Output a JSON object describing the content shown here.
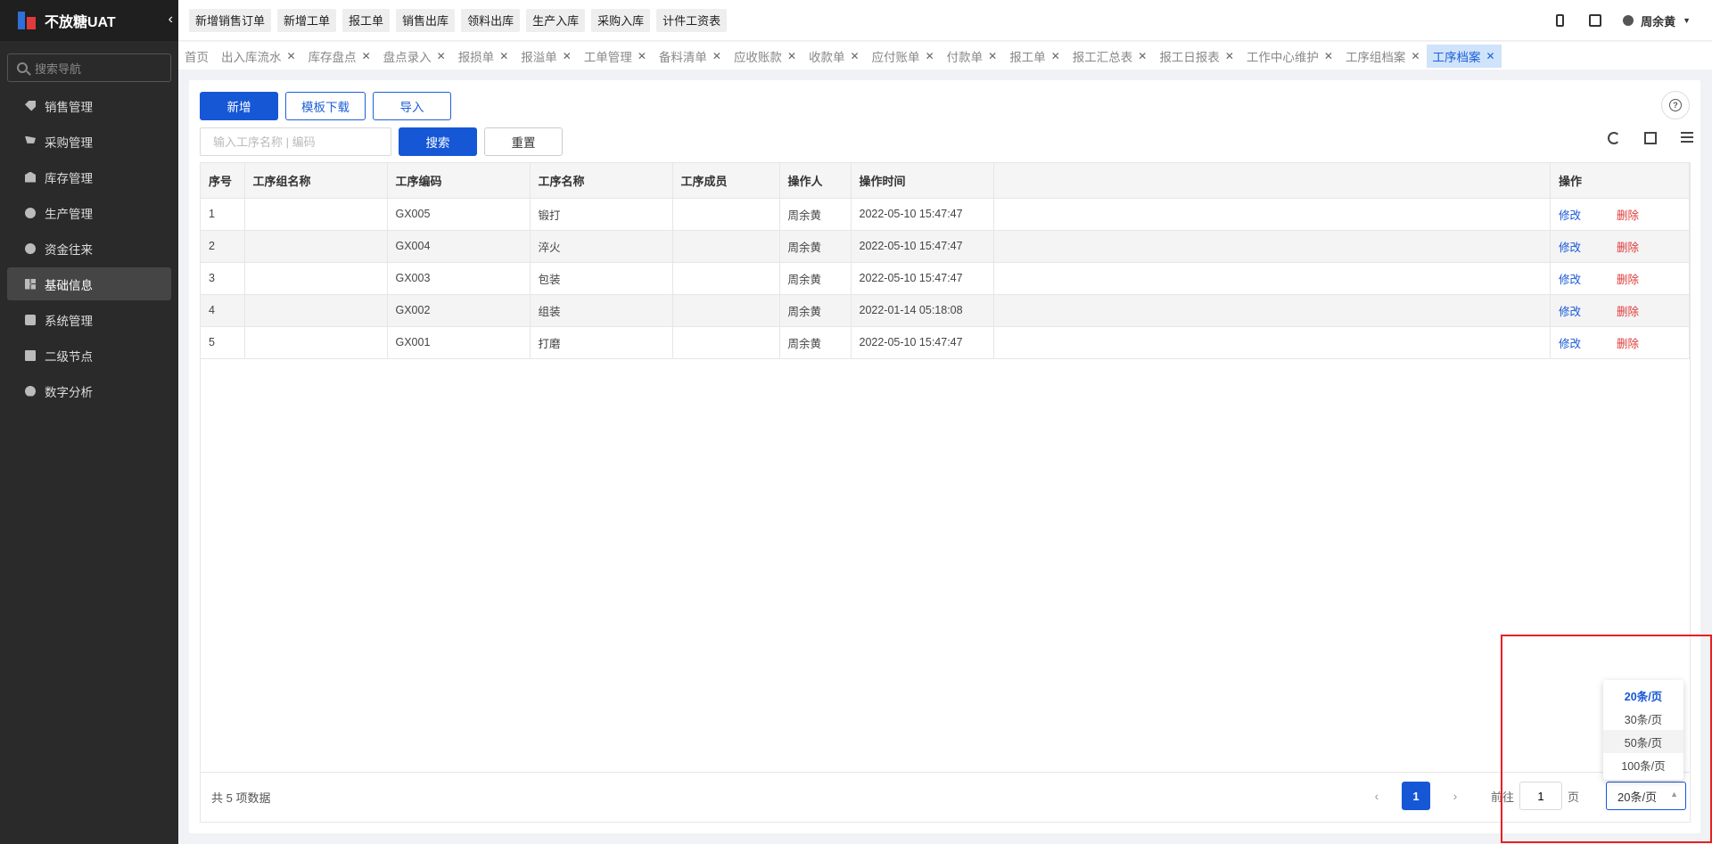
{
  "app": {
    "title": "不放糖UAT"
  },
  "sidebar": {
    "search_placeholder": "搜索导航",
    "items": [
      {
        "label": "销售管理",
        "icon": "tag-icon"
      },
      {
        "label": "采购管理",
        "icon": "cart-icon"
      },
      {
        "label": "库存管理",
        "icon": "warehouse-icon"
      },
      {
        "label": "生产管理",
        "icon": "production-icon"
      },
      {
        "label": "资金往来",
        "icon": "money-icon"
      },
      {
        "label": "基础信息",
        "icon": "grid-icon"
      },
      {
        "label": "系统管理",
        "icon": "apps-icon"
      },
      {
        "label": "二级节点",
        "icon": "document-icon"
      },
      {
        "label": "数字分析",
        "icon": "pie-chart-icon"
      }
    ],
    "active_index": 5
  },
  "quick_actions": [
    "新增销售订单",
    "新增工单",
    "报工单",
    "销售出库",
    "领料出库",
    "生产入库",
    "采购入库",
    "计件工资表"
  ],
  "user": {
    "name": "周余黄"
  },
  "tabs": [
    "首页",
    "出入库流水",
    "库存盘点",
    "盘点录入",
    "报损单",
    "报溢单",
    "工单管理",
    "备料清单",
    "应收账款",
    "收款单",
    "应付账单",
    "付款单",
    "报工单",
    "报工汇总表",
    "报工日报表",
    "工作中心维护",
    "工序组档案",
    "工序档案"
  ],
  "toolbar": {
    "add_label": "新增",
    "template_label": "模板下载",
    "import_label": "导入",
    "search_placeholder": "输入工序名称 | 编码",
    "search_label": "搜索",
    "reset_label": "重置"
  },
  "table": {
    "headers": {
      "index": "序号",
      "group_name": "工序组名称",
      "code": "工序编码",
      "name": "工序名称",
      "members": "工序成员",
      "operator": "操作人",
      "time": "操作时间",
      "actions": "操作"
    },
    "rows": [
      {
        "index": "1",
        "group_name": "",
        "code": "GX005",
        "name": "锻打",
        "members": "",
        "operator": "周余黄",
        "time": "2022-05-10 15:47:47"
      },
      {
        "index": "2",
        "group_name": "",
        "code": "GX004",
        "name": "淬火",
        "members": "",
        "operator": "周余黄",
        "time": "2022-05-10 15:47:47"
      },
      {
        "index": "3",
        "group_name": "",
        "code": "GX003",
        "name": "包装",
        "members": "",
        "operator": "周余黄",
        "time": "2022-05-10 15:47:47"
      },
      {
        "index": "4",
        "group_name": "",
        "code": "GX002",
        "name": "组装",
        "members": "",
        "operator": "周余黄",
        "time": "2022-01-14 05:18:08"
      },
      {
        "index": "5",
        "group_name": "",
        "code": "GX001",
        "name": "打磨",
        "members": "",
        "operator": "周余黄",
        "time": "2022-05-10 15:47:47"
      }
    ],
    "edit_label": "修改",
    "delete_label": "删除"
  },
  "pagination": {
    "total_text": "共 5 项数据",
    "prev": "‹",
    "next": "›",
    "current_page": "1",
    "goto_label": "前往",
    "goto_value": "1",
    "page_unit": "页",
    "page_size": "20条/页",
    "page_size_options": [
      "20条/页",
      "30条/页",
      "50条/页",
      "100条/页"
    ]
  }
}
